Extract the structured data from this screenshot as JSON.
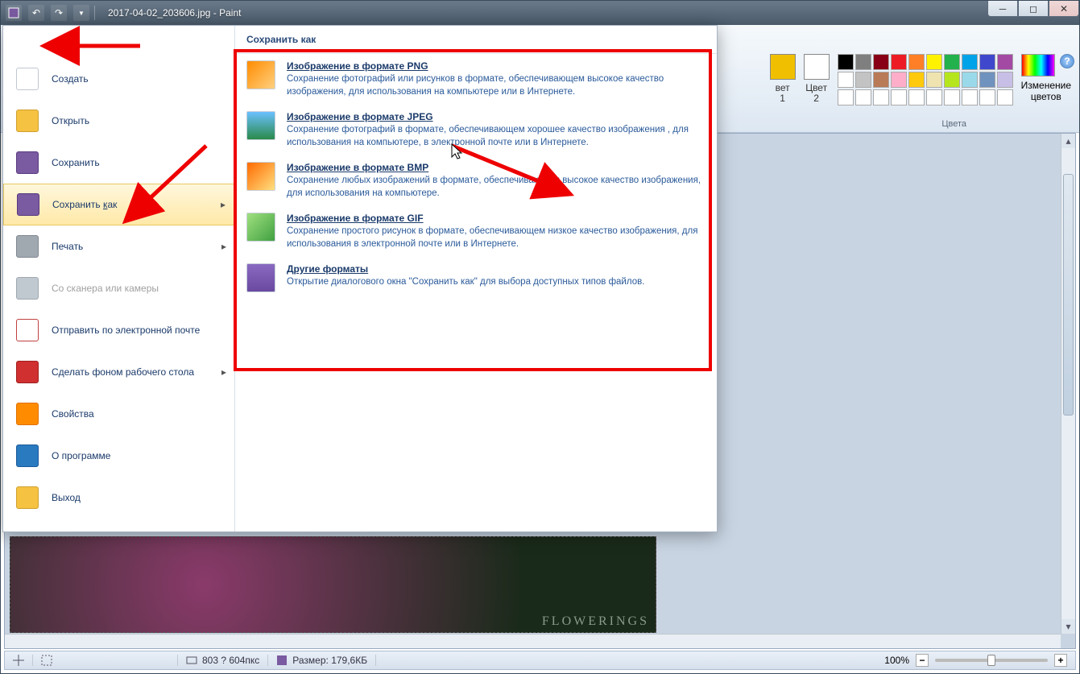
{
  "window": {
    "title": "2017-04-02_203606.jpg - Paint"
  },
  "ribbon": {
    "colors_group_label": "Цвета",
    "color1_label_line1": "вет",
    "color1_label_line2": "1",
    "color2_label_line1": "Цвет",
    "color2_label_line2": "2",
    "edit_colors_line1": "Изменение",
    "edit_colors_line2": "цветов",
    "palette_row1": [
      "#000000",
      "#7f7f7f",
      "#880015",
      "#ed1c24",
      "#ff7f27",
      "#fff200",
      "#22b14c",
      "#00a2e8",
      "#3f48cc",
      "#a349a4"
    ],
    "palette_row2": [
      "#ffffff",
      "#c3c3c3",
      "#b97a57",
      "#ffaec9",
      "#ffc90e",
      "#efe4b0",
      "#b5e61d",
      "#99d9ea",
      "#7092be",
      "#c8bfe7"
    ],
    "palette_row3": [
      "#ffffff",
      "#ffffff",
      "#ffffff",
      "#ffffff",
      "#ffffff",
      "#ffffff",
      "#ffffff",
      "#ffffff",
      "#ffffff",
      "#ffffff"
    ],
    "color1_swatch": "#f0c000",
    "color2_swatch": "#ffffff"
  },
  "file_menu": {
    "items": [
      {
        "label": "Создать",
        "highlighted": false,
        "disabled": false,
        "sub": false,
        "icon": "#ffffff",
        "icon_border": "#c0c8d0"
      },
      {
        "label": "Открыть",
        "highlighted": false,
        "disabled": false,
        "sub": false,
        "icon": "#f5c242",
        "icon_border": "#d0a030"
      },
      {
        "label": "Сохранить",
        "highlighted": false,
        "disabled": false,
        "sub": false,
        "icon": "#7a5aa0",
        "icon_border": "#5a3a80"
      },
      {
        "label": "Сохранить как",
        "highlighted": true,
        "disabled": false,
        "sub": true,
        "icon": "#7a5aa0",
        "icon_border": "#5a3a80"
      },
      {
        "label": "Печать",
        "highlighted": false,
        "disabled": false,
        "sub": true,
        "icon": "#a0a8b0",
        "icon_border": "#808890"
      },
      {
        "label": "Со сканера или камеры",
        "highlighted": false,
        "disabled": true,
        "sub": false,
        "icon": "#c0c8d0",
        "icon_border": "#a0a8b0"
      },
      {
        "label": "Отправить по электронной почте",
        "highlighted": false,
        "disabled": false,
        "sub": false,
        "icon": "#ffffff",
        "icon_border": "#c04040"
      },
      {
        "label": "Сделать фоном рабочего стола",
        "highlighted": false,
        "disabled": false,
        "sub": true,
        "icon": "#d03030",
        "icon_border": "#a02020"
      },
      {
        "label": "Свойства",
        "highlighted": false,
        "disabled": false,
        "sub": false,
        "icon": "#ff8c00",
        "icon_border": "#e07000"
      },
      {
        "label": "О программе",
        "highlighted": false,
        "disabled": false,
        "sub": false,
        "icon": "#2a7ac0",
        "icon_border": "#1a5a9a"
      },
      {
        "label": "Выход",
        "highlighted": false,
        "disabled": false,
        "sub": false,
        "icon": "#f5c242",
        "icon_border": "#d0a030"
      }
    ],
    "submenu_heading": "Сохранить как",
    "submenu_options": [
      {
        "title": "Изображение в формате PNG",
        "desc": "Сохранение фотографий или рисунков в формате, обеспечивающем высокое качество изображения, для использования на компьютере или в Интернете.",
        "icon_bg": "linear-gradient(135deg,#ff8c00,#ffd080)"
      },
      {
        "title": "Изображение в формате JPEG",
        "desc": "Сохранение фотографий в формате, обеспечивающем хорошее качество изображения , для использования на компьютере, в электронной почте или в Интернете.",
        "icon_bg": "linear-gradient(#6ac0ff,#2a8a4a)"
      },
      {
        "title": "Изображение в формате BMP",
        "desc": "Сохранение любых изображений в формате, обеспечивающем высокое качество изображения, для использования на компьютере.",
        "icon_bg": "linear-gradient(135deg,#ff6a00,#ffe080)"
      },
      {
        "title": "Изображение в формате GIF",
        "desc": "Сохранение простого рисунок в формате, обеспечивающем низкое качество изображения, для использования в электронной почте или в Интернете.",
        "icon_bg": "linear-gradient(135deg,#a0e080,#40a040)"
      },
      {
        "title": "Другие форматы",
        "desc": "Открытие диалогового окна \"Сохранить как\" для выбора доступных типов файлов.",
        "icon_bg": "linear-gradient(#8a6ac0,#6a4aa0)"
      }
    ]
  },
  "statusbar": {
    "dimensions": "803 ? 604пкс",
    "size_label": "Размер: 179,6КБ",
    "zoom": "100%"
  },
  "canvas": {
    "watermark": "FLOWERINGS"
  }
}
